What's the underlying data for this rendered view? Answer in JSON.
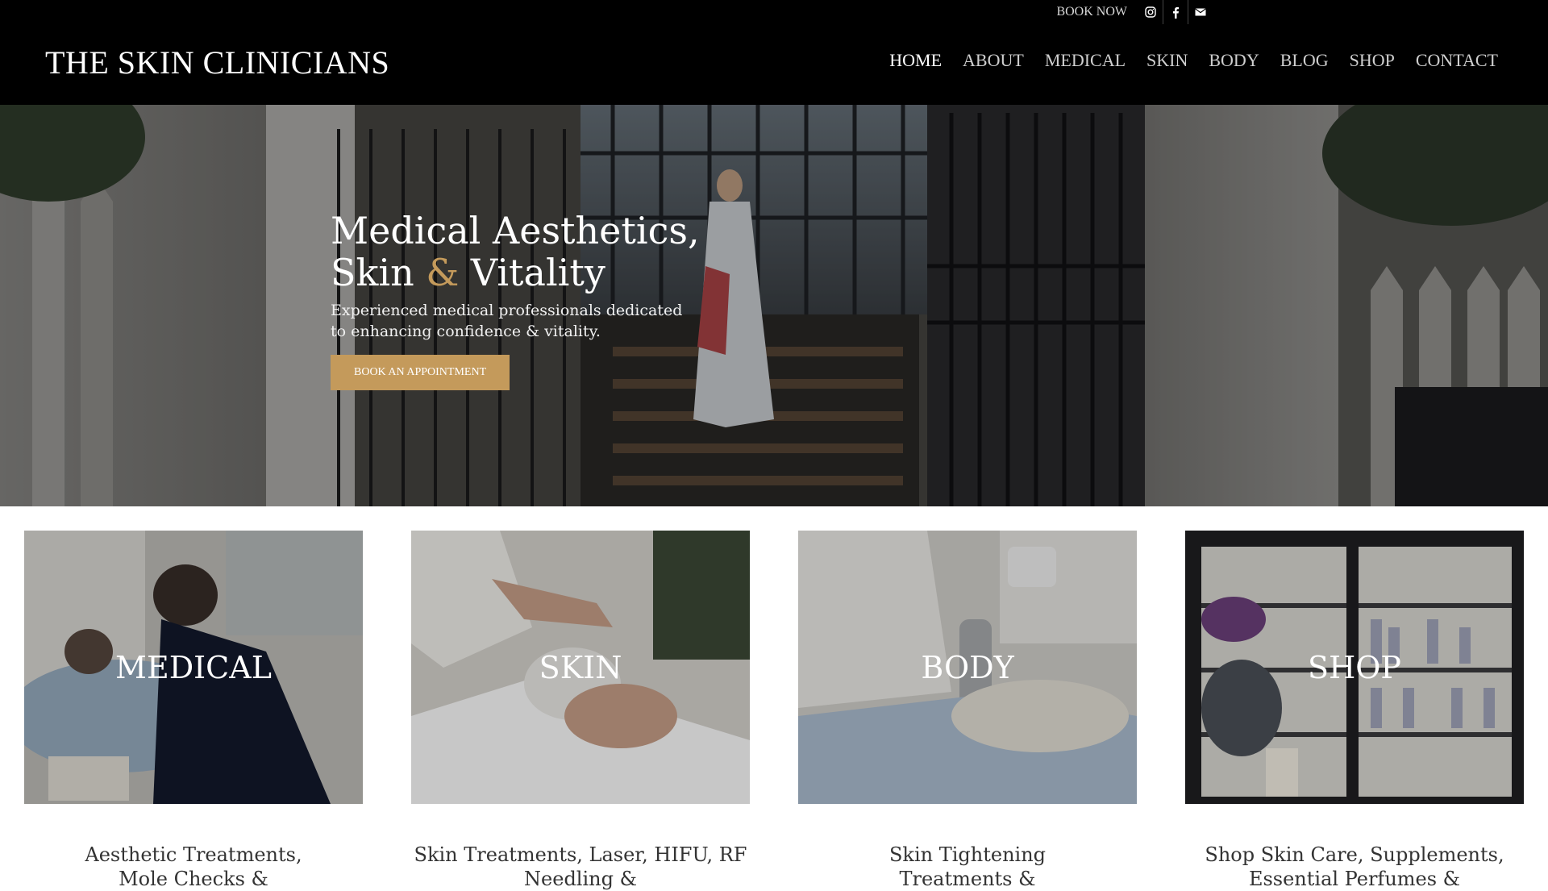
{
  "header": {
    "logo": "THE SKIN CLINICIANS",
    "utility": {
      "book_label": "BOOK NOW",
      "icons": [
        "instagram-icon",
        "facebook-icon",
        "mail-icon"
      ]
    },
    "nav": [
      {
        "label": "HOME",
        "active": true
      },
      {
        "label": "ABOUT"
      },
      {
        "label": "MEDICAL"
      },
      {
        "label": "SKIN"
      },
      {
        "label": "BODY"
      },
      {
        "label": "BLOG"
      },
      {
        "label": "SHOP"
      },
      {
        "label": "CONTACT"
      }
    ]
  },
  "hero": {
    "title_line1": "Medical Aesthetics,",
    "title_line2_a": "Skin ",
    "title_amp": "&",
    "title_line2_b": " Vitality",
    "subtitle_line1": "Experienced medical professionals dedicated",
    "subtitle_line2": "to enhancing confidence & vitality.",
    "button": "BOOK AN APPOINTMENT"
  },
  "cards": [
    {
      "title": "MEDICAL",
      "desc_line1": "Aesthetic Treatments,",
      "desc_line2": "Mole Checks &"
    },
    {
      "title": "SKIN",
      "desc_line1": "Skin Treatments, Laser, HIFU, RF",
      "desc_line2": "Needling &"
    },
    {
      "title": "BODY",
      "desc_line1": "Skin Tightening",
      "desc_line2": "Treatments &"
    },
    {
      "title": "SHOP",
      "desc_line1": "Shop Skin Care, Supplements,",
      "desc_line2": "Essential Perfumes &"
    }
  ],
  "colors": {
    "accent": "#c49a5b",
    "header_bg": "#000000"
  }
}
